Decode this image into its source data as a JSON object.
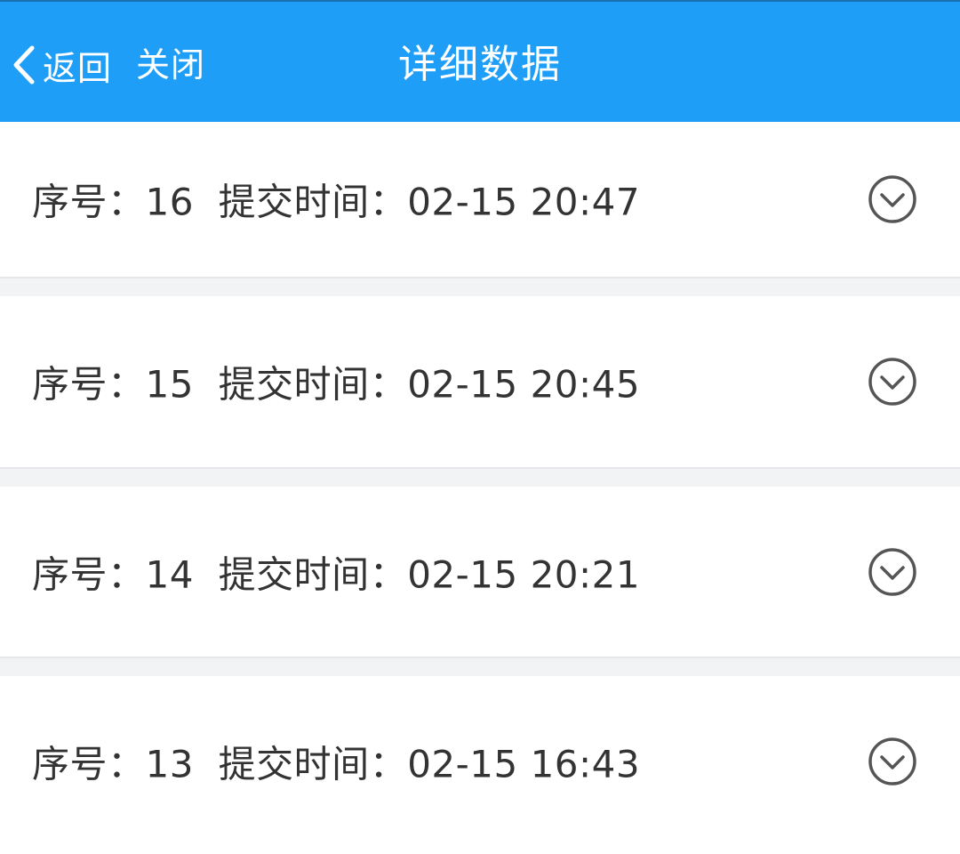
{
  "header": {
    "back_label": "返回",
    "close_label": "关闭",
    "title": "详细数据",
    "background_color": "#1f9ef7"
  },
  "records": [
    {
      "seq_label": "序号：",
      "seq": "16",
      "time_label": "提交时间：",
      "time": "02-15 20:47",
      "icon": "chevron-down-circle-icon"
    },
    {
      "seq_label": "序号：",
      "seq": "15",
      "time_label": "提交时间：",
      "time": "02-15 20:45",
      "icon": "chevron-down-circle-icon"
    },
    {
      "seq_label": "序号：",
      "seq": "14",
      "time_label": "提交时间：",
      "time": "02-15 20:21",
      "icon": "chevron-down-circle-icon"
    },
    {
      "seq_label": "序号：",
      "seq": "13",
      "time_label": "提交时间：",
      "time": "02-15 16:43",
      "icon": "chevron-down-circle-icon"
    }
  ]
}
